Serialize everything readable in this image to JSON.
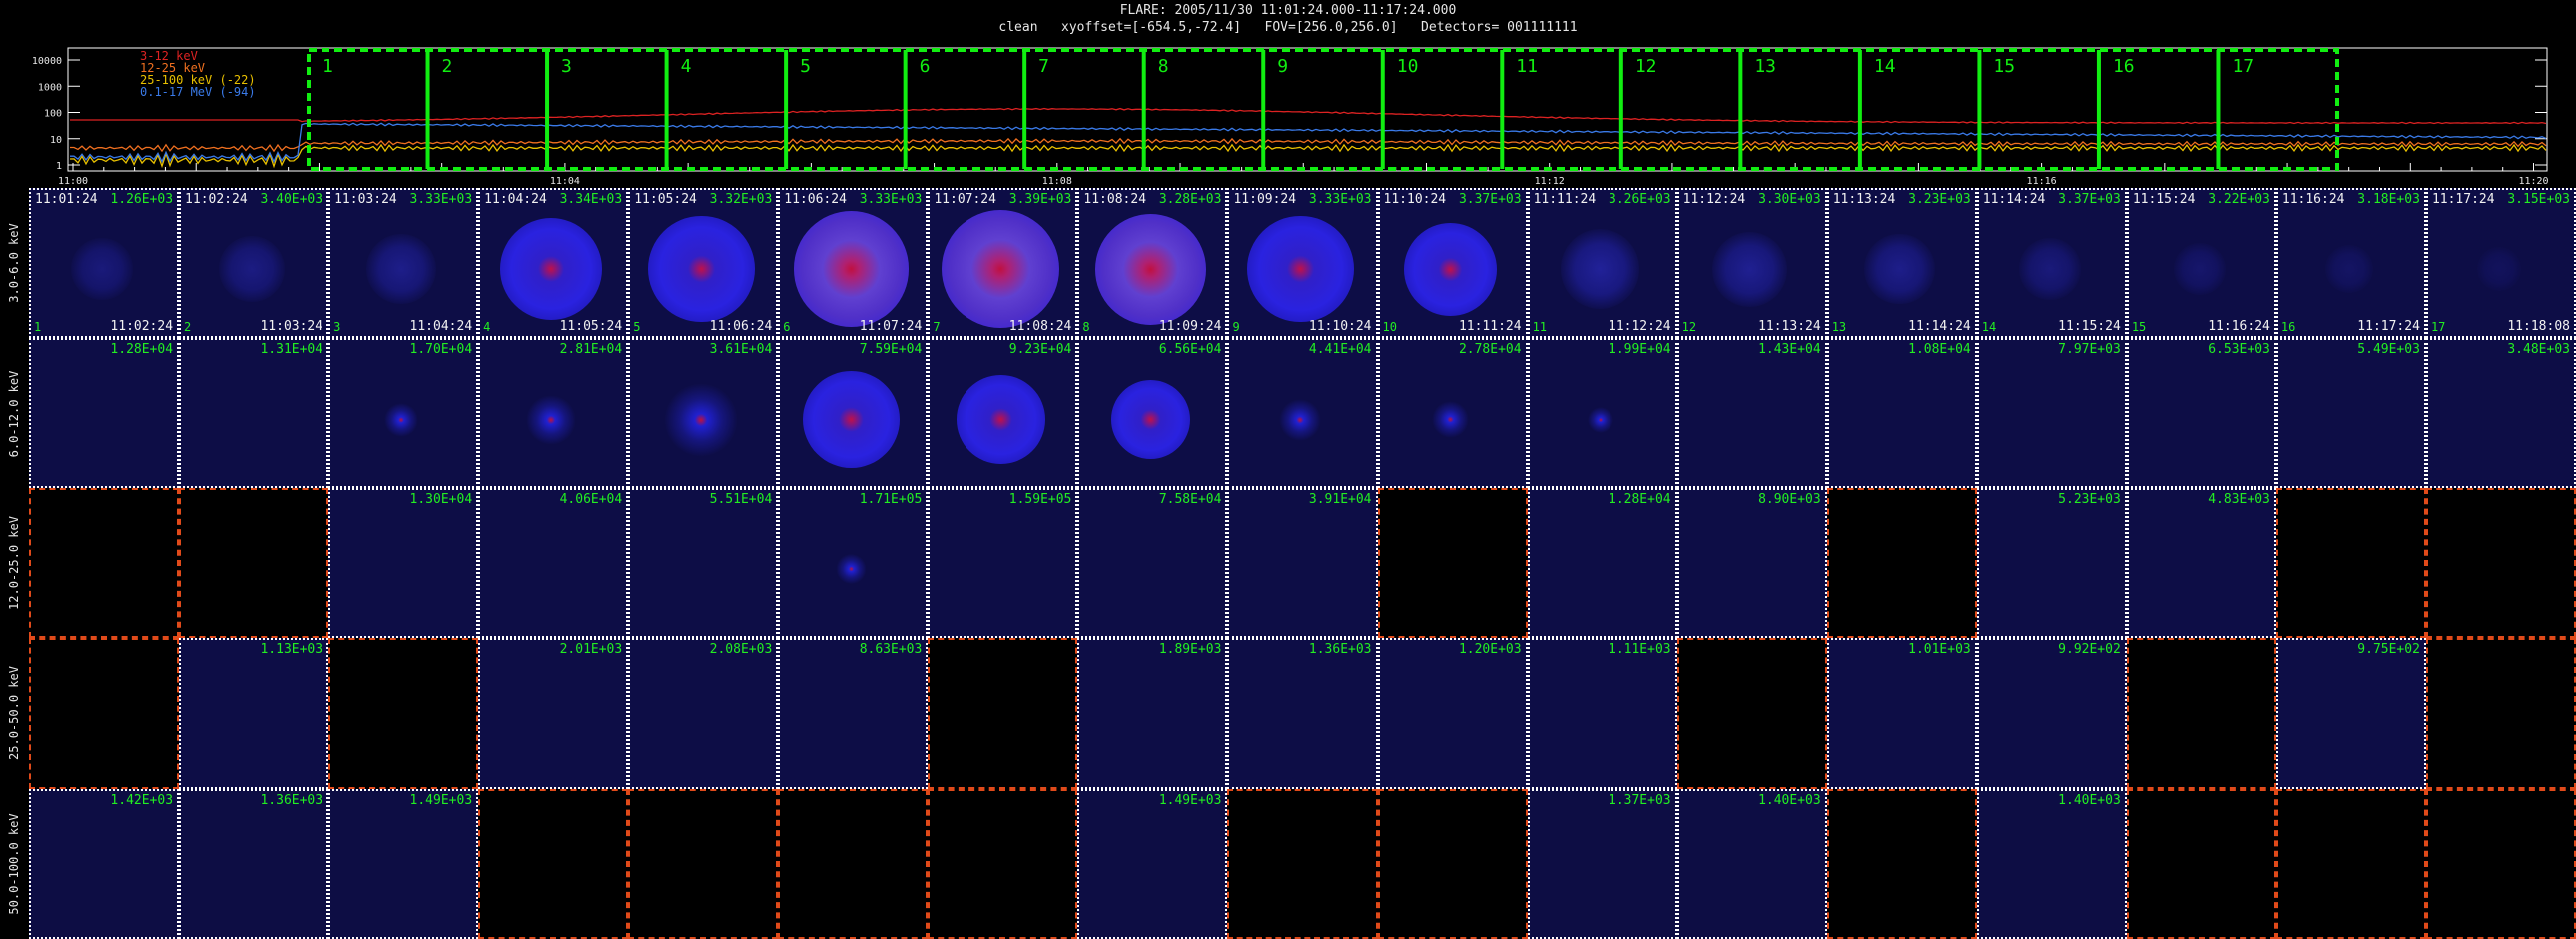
{
  "header": {
    "title": "FLARE: 2005/11/30 11:01:24.000-11:17:24.000",
    "subtitle": "clean   xyoffset=[-654.5,-72.4]   FOV=[256.0,256.0]   Detectors= 001111111"
  },
  "lightcurve": {
    "legend": [
      {
        "label": "3-12 keV",
        "color": "#dd2222"
      },
      {
        "label": "12-25 keV",
        "color": "#f07020"
      },
      {
        "label": "25-100 keV (-22)",
        "color": "#e8c000"
      },
      {
        "label": "0.1-17 MeV (-94)",
        "color": "#3a7ae8"
      }
    ],
    "y_tick_labels": [
      "10000",
      "1000",
      "100",
      "10",
      "1"
    ],
    "x_tick_labels": [
      "11:00",
      "11:04",
      "11:08",
      "11:12",
      "11:16",
      "11:20"
    ],
    "intervals": [
      "1",
      "2",
      "3",
      "4",
      "5",
      "6",
      "7",
      "8",
      "9",
      "10",
      "11",
      "12",
      "13",
      "14",
      "15",
      "16",
      "17"
    ],
    "interval_color": "#11ee11"
  },
  "row_labels": [
    "3.0-6.0 keV",
    "6.0-12.0 keV",
    "12.0-25.0 keV",
    "25.0-50.0 keV",
    "50.0-100.0 keV"
  ],
  "rows": [
    {
      "start_times": [
        "11:01:24",
        "11:02:24",
        "11:03:24",
        "11:04:24",
        "11:05:24",
        "11:06:24",
        "11:07:24",
        "11:08:24",
        "11:09:24",
        "11:10:24",
        "11:11:24",
        "11:12:24",
        "11:13:24",
        "11:14:24",
        "11:15:24",
        "11:16:24",
        "11:17:24"
      ],
      "end_times": [
        "11:02:24",
        "11:03:24",
        "11:04:24",
        "11:05:24",
        "11:06:24",
        "11:07:24",
        "11:08:24",
        "11:09:24",
        "11:10:24",
        "11:11:24",
        "11:12:24",
        "11:13:24",
        "11:14:24",
        "11:15:24",
        "11:16:24",
        "11:17:24",
        "11:18:08"
      ],
      "numbers": [
        "1",
        "2",
        "3",
        "4",
        "5",
        "6",
        "7",
        "8",
        "9",
        "10",
        "11",
        "12",
        "13",
        "14",
        "15",
        "16",
        "17"
      ],
      "values": [
        "1.26E+03",
        "3.40E+03",
        "3.33E+03",
        "3.34E+03",
        "3.32E+03",
        "3.33E+03",
        "3.39E+03",
        "3.28E+03",
        "3.33E+03",
        "3.37E+03",
        "3.26E+03",
        "3.30E+03",
        "3.23E+03",
        "3.37E+03",
        "3.22E+03",
        "3.18E+03",
        "3.15E+03"
      ]
    },
    {
      "values": [
        "1.28E+04",
        "1.31E+04",
        "1.70E+04",
        "2.81E+04",
        "3.61E+04",
        "7.59E+04",
        "9.23E+04",
        "6.56E+04",
        "4.41E+04",
        "2.78E+04",
        "1.99E+04",
        "1.43E+04",
        "1.08E+04",
        "7.97E+03",
        "6.53E+03",
        "5.49E+03",
        "3.48E+03"
      ]
    },
    {
      "values": [
        "",
        "",
        "1.30E+04",
        "4.06E+04",
        "5.51E+04",
        "1.71E+05",
        "1.59E+05",
        "7.58E+04",
        "3.91E+04",
        "",
        "1.28E+04",
        "8.90E+03",
        "",
        "5.23E+03",
        "4.83E+03",
        "",
        ""
      ]
    },
    {
      "values": [
        "",
        "1.13E+03",
        "",
        "2.01E+03",
        "2.08E+03",
        "8.63E+03",
        "",
        "1.89E+03",
        "1.36E+03",
        "1.20E+03",
        "1.11E+03",
        "",
        "1.01E+03",
        "9.92E+02",
        "",
        "9.75E+02",
        ""
      ]
    },
    {
      "values": [
        "1.42E+03",
        "1.36E+03",
        "1.49E+03",
        "",
        "",
        "",
        "",
        "1.49E+03",
        "",
        "",
        "1.37E+03",
        "1.40E+03",
        "",
        "1.40E+03",
        "",
        "",
        ""
      ]
    }
  ],
  "cell_visual": [
    [
      [
        0.35,
        "d"
      ],
      [
        0.4,
        "d"
      ],
      [
        0.45,
        "d"
      ],
      [
        0.8,
        "r"
      ],
      [
        0.85,
        "r"
      ],
      [
        0.95,
        "rr"
      ],
      [
        0.98,
        "rr"
      ],
      [
        0.9,
        "rr"
      ],
      [
        0.85,
        "r"
      ],
      [
        0.7,
        "r"
      ],
      [
        0.55,
        "d"
      ],
      [
        0.5,
        "d"
      ],
      [
        0.45,
        "d"
      ],
      [
        0.35,
        "d"
      ],
      [
        0.25,
        "d"
      ],
      [
        0.2,
        "d"
      ],
      [
        0.15,
        "d"
      ]
    ],
    [
      [
        0,
        "n"
      ],
      [
        0,
        "n"
      ],
      [
        0.1,
        "s"
      ],
      [
        0.2,
        "s"
      ],
      [
        0.35,
        "s"
      ],
      [
        0.75,
        "r"
      ],
      [
        0.65,
        "r"
      ],
      [
        0.55,
        "r"
      ],
      [
        0.15,
        "s"
      ],
      [
        0.12,
        "s"
      ],
      [
        0.05,
        "s"
      ],
      [
        0,
        "n"
      ],
      [
        0,
        "n"
      ],
      [
        0,
        "n"
      ],
      [
        0,
        "n"
      ],
      [
        0,
        "n"
      ],
      [
        0,
        "n"
      ]
    ],
    [
      [
        0,
        "x"
      ],
      [
        0,
        "x"
      ],
      [
        0,
        "n"
      ],
      [
        0,
        "n"
      ],
      [
        0,
        "n"
      ],
      [
        0.08,
        "s"
      ],
      [
        0,
        "n"
      ],
      [
        0,
        "n"
      ],
      [
        0,
        "n"
      ],
      [
        0,
        "x"
      ],
      [
        0,
        "n"
      ],
      [
        0,
        "n"
      ],
      [
        0,
        "x"
      ],
      [
        0,
        "n"
      ],
      [
        0,
        "n"
      ],
      [
        0,
        "x"
      ],
      [
        0,
        "x"
      ]
    ],
    [
      [
        0,
        "x"
      ],
      [
        0,
        "n"
      ],
      [
        0,
        "x"
      ],
      [
        0,
        "n"
      ],
      [
        0,
        "n"
      ],
      [
        0,
        "n"
      ],
      [
        0,
        "x"
      ],
      [
        0,
        "n"
      ],
      [
        0,
        "n"
      ],
      [
        0,
        "n"
      ],
      [
        0,
        "n"
      ],
      [
        0,
        "x"
      ],
      [
        0,
        "n"
      ],
      [
        0,
        "n"
      ],
      [
        0,
        "x"
      ],
      [
        0,
        "n"
      ],
      [
        0,
        "x"
      ]
    ],
    [
      [
        0,
        "z"
      ],
      [
        0,
        "z"
      ],
      [
        0,
        "z"
      ],
      [
        0,
        "x"
      ],
      [
        0,
        "x"
      ],
      [
        0,
        "x"
      ],
      [
        0,
        "x"
      ],
      [
        0,
        "z"
      ],
      [
        0,
        "x"
      ],
      [
        0,
        "x"
      ],
      [
        0,
        "z"
      ],
      [
        0,
        "z"
      ],
      [
        0,
        "x"
      ],
      [
        0,
        "z"
      ],
      [
        0,
        "x"
      ],
      [
        0,
        "x"
      ],
      [
        0,
        "x"
      ]
    ]
  ]
}
